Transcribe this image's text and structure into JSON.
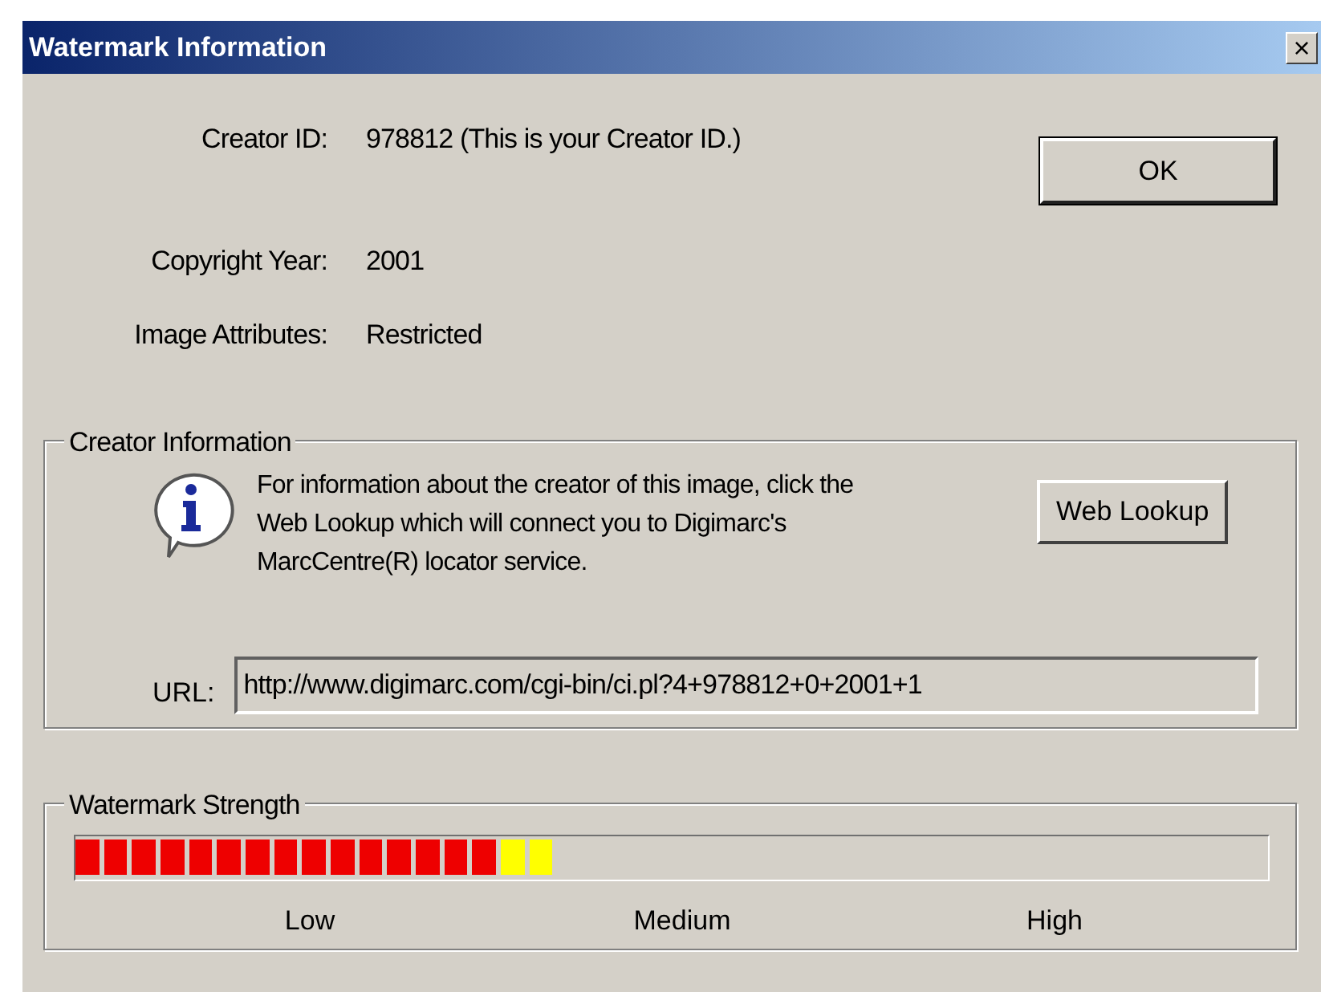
{
  "window": {
    "title": "Watermark Information",
    "close": "×"
  },
  "fields": [
    {
      "label": "Creator ID:",
      "value": "978812  (This is your Creator ID.)"
    },
    {
      "label": "Copyright Year:",
      "value": "2001"
    },
    {
      "label": "Image Attributes:",
      "value": "Restricted"
    }
  ],
  "ok_button": "OK",
  "creator_info": {
    "title": "Creator Information",
    "message": "For information about the creator of this image, click the Web Lookup which will connect you to Digimarc's  MarcCentre(R) locator service.",
    "button": "Web Lookup",
    "url_label": "URL:",
    "url": "http://www.digimarc.com/cgi-bin/ci.pl?4+978812+0+2001+1"
  },
  "strength": {
    "title": "Watermark Strength",
    "level": 0.4,
    "scale": [
      "Low",
      "Medium",
      "High"
    ]
  }
}
